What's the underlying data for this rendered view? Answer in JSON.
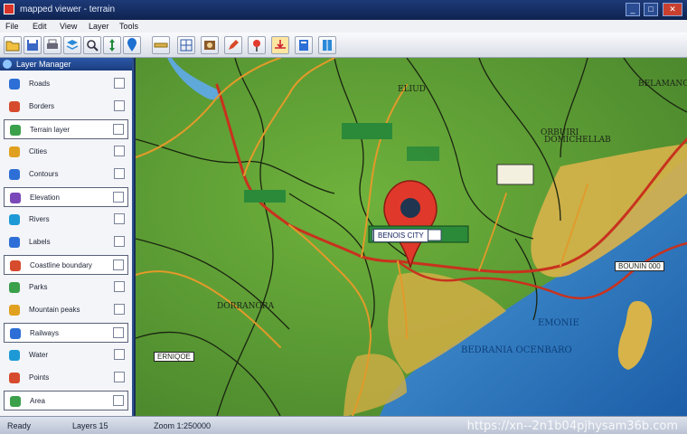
{
  "window": {
    "title": "mapped viewer - terrain",
    "minimize": "_",
    "maximize": "□",
    "close": "✕"
  },
  "menu": [
    "File",
    "Edit",
    "View",
    "Layer",
    "Tools"
  ],
  "toolbar": {
    "tools": [
      "folder-icon",
      "save-icon",
      "print-icon",
      "layers-icon",
      "zoom-icon",
      "pan-icon",
      "marker-icon",
      "ruler-icon",
      "grid-icon",
      "photo-icon",
      "pencil-icon",
      "pin-icon",
      "export-icon",
      "info-icon"
    ]
  },
  "sidebar": {
    "header": "Layer Manager",
    "items": [
      {
        "label": "Roads",
        "color": "#2d6fd6"
      },
      {
        "label": "Borders",
        "color": "#d64b2d"
      },
      {
        "label": "Terrain layer",
        "color": "#3aa04a"
      },
      {
        "label": "Cities",
        "color": "#e0a020"
      },
      {
        "label": "Contours",
        "color": "#2d6fd6"
      },
      {
        "label": "Elevation",
        "color": "#7a48b8"
      },
      {
        "label": "Rivers",
        "color": "#1d9ad6"
      },
      {
        "label": "Labels",
        "color": "#2d6fd6"
      },
      {
        "label": "Coastline boundary",
        "color": "#d64b2d"
      },
      {
        "label": "Parks",
        "color": "#3aa04a"
      },
      {
        "label": "Mountain peaks",
        "color": "#e0a020"
      },
      {
        "label": "Railways",
        "color": "#2d6fd6"
      },
      {
        "label": "Water",
        "color": "#1d9ad6"
      },
      {
        "label": "Points",
        "color": "#d64b2d"
      },
      {
        "label": "Area",
        "color": "#3aa04a"
      }
    ]
  },
  "map": {
    "labels": {
      "north": "ELIUD",
      "northeast": "BELAMANO",
      "east_top": "ORBUIRI",
      "center": "DOMICHELLAB",
      "west": "DORRANORA",
      "southwest": "ERNIQOE",
      "harbor": "BOUNIN 000",
      "sea": "BEDRANIA OCENBARO",
      "island": "EMONIE"
    },
    "pin_caption": "BENOIS CITY"
  },
  "statusbar": {
    "left": "Ready",
    "mid": "Layers 15",
    "right": "Zoom 1:250000"
  },
  "watermark": "https://xn--2n1b04pjhysam36b.com"
}
